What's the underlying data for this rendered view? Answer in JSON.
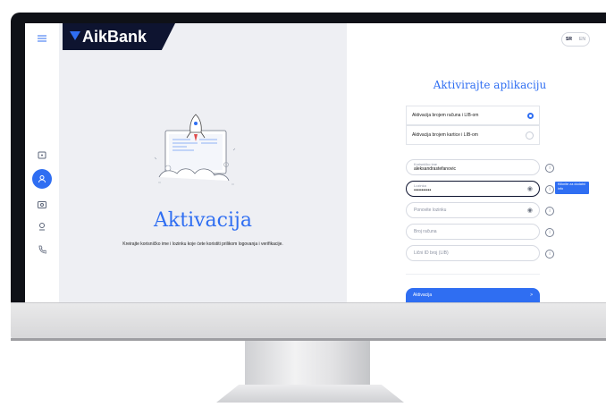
{
  "brand": {
    "name": "AikBank"
  },
  "language": {
    "active": "SR",
    "other": "EN"
  },
  "sidebar": {
    "icons": [
      "menu-icon",
      "wallet-icon",
      "user-icon",
      "card-icon",
      "support-icon",
      "phone-icon"
    ]
  },
  "hero": {
    "title": "Aktivacija",
    "subtitle": "Kreirajte korisničko ime i lozinku koje ćete koristiti prilikom logovanja i verifikacije."
  },
  "form": {
    "title": "Aktivirajte aplikaciju",
    "options": [
      {
        "label": "Aktivacija brojem računa i LIB-om",
        "selected": true
      },
      {
        "label": "Aktivacija brojem kartice i LIB-om",
        "selected": false
      }
    ],
    "username": {
      "label": "Korisničko ime",
      "value": "aleksandrastefanovic"
    },
    "password": {
      "label": "Lozinka",
      "value": "•••••••••••"
    },
    "repeat_password": {
      "placeholder": "Ponovite lozinku"
    },
    "account_number": {
      "placeholder": "Broj računa"
    },
    "lib": {
      "placeholder": "Lični ID broj (LIB)"
    },
    "tooltip": "Kliknite za dodatni info",
    "submit_label": "Aktivacija",
    "submit_arrow": ">"
  },
  "colors": {
    "accent": "#2f6ef2",
    "brand_dark": "#0e1430"
  }
}
